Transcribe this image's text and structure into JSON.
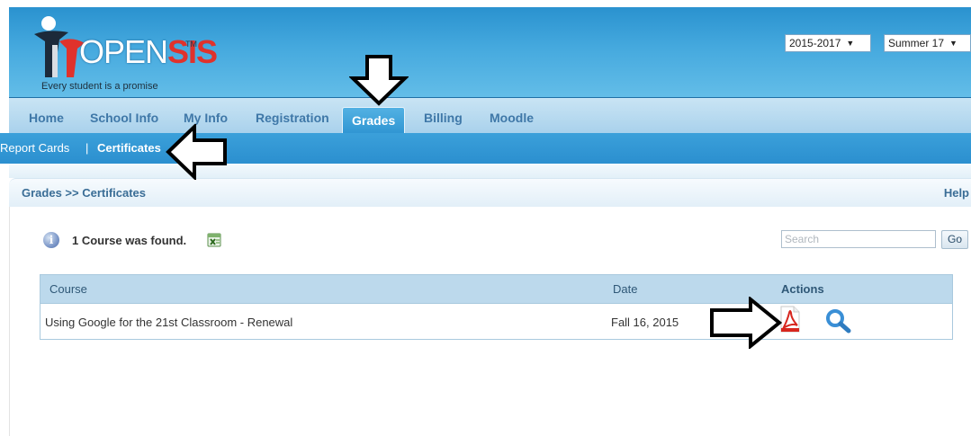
{
  "header": {
    "logo": {
      "brand_open": "OPEN",
      "brand_sis": "SIS",
      "trademark": "TM",
      "tagline": "Every student is a promise"
    },
    "school_year": {
      "value": "2015-2017"
    },
    "term": {
      "value": "Summer 17"
    }
  },
  "nav": {
    "items": [
      {
        "label": "Home"
      },
      {
        "label": "School Info"
      },
      {
        "label": "My Info"
      },
      {
        "label": "Registration"
      },
      {
        "label": "Grades"
      },
      {
        "label": "Billing"
      },
      {
        "label": "Moodle"
      }
    ],
    "active": "Grades"
  },
  "subnav": {
    "report_cards": "Report Cards",
    "separator": "|",
    "certificates": "Certificates"
  },
  "breadcrumb": {
    "text": "Grades >> Certificates",
    "help": "Help"
  },
  "results": {
    "message": "1 Course was found.",
    "search_placeholder": "Search",
    "go_label": "Go"
  },
  "table": {
    "headers": {
      "course": "Course",
      "date": "Date",
      "actions": "Actions"
    },
    "rows": [
      {
        "course": "Using Google for the 21st Classroom - Renewal",
        "date": "Fall 16, 2015"
      }
    ]
  },
  "colors": {
    "header_blue": "#2a92cf",
    "nav_light": "#bfdff1",
    "subnav_blue": "#2b8fcf",
    "table_header": "#bcd9ec",
    "pdf_red": "#d7261e",
    "zoom_blue": "#3a8fd6"
  },
  "icons": [
    "info-icon",
    "excel-icon",
    "pdf-icon",
    "zoom-icon",
    "arrow-down-annotation",
    "arrow-left-annotation",
    "arrow-right-annotation"
  ]
}
